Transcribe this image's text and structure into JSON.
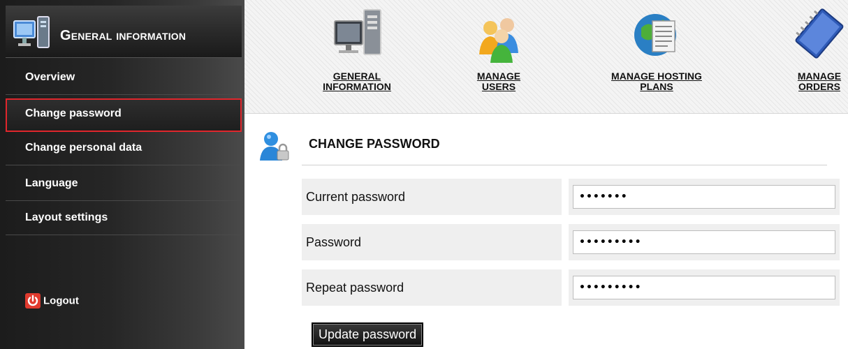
{
  "sidebar": {
    "header_title": "General information",
    "items": [
      {
        "label": "Overview"
      },
      {
        "label": "Change password"
      },
      {
        "label": "Change personal data"
      },
      {
        "label": "Language"
      },
      {
        "label": "Layout settings"
      }
    ],
    "active_item": "Change password",
    "logout_label": "Logout"
  },
  "toolbar": {
    "items": [
      {
        "line1": "General",
        "line2": "information",
        "icon": "computer-icon"
      },
      {
        "line1": "Manage",
        "line2": "users",
        "icon": "users-icon"
      },
      {
        "line1": "Manage hosting",
        "line2": "plans",
        "icon": "globe-document-icon"
      },
      {
        "line1": "Manage",
        "line2": "Orders",
        "icon": "notebook-icon"
      }
    ]
  },
  "content": {
    "title": "Change password",
    "fields": [
      {
        "label": "Current password",
        "value": "•••••••"
      },
      {
        "label": "Password",
        "value": "•••••••••"
      },
      {
        "label": "Repeat password",
        "value": "•••••••••"
      }
    ],
    "submit_label": "Update password"
  },
  "colors": {
    "active_border": "#e0262c",
    "sidebar_bg": "#1c1c1c",
    "field_bg": "#efefef"
  }
}
